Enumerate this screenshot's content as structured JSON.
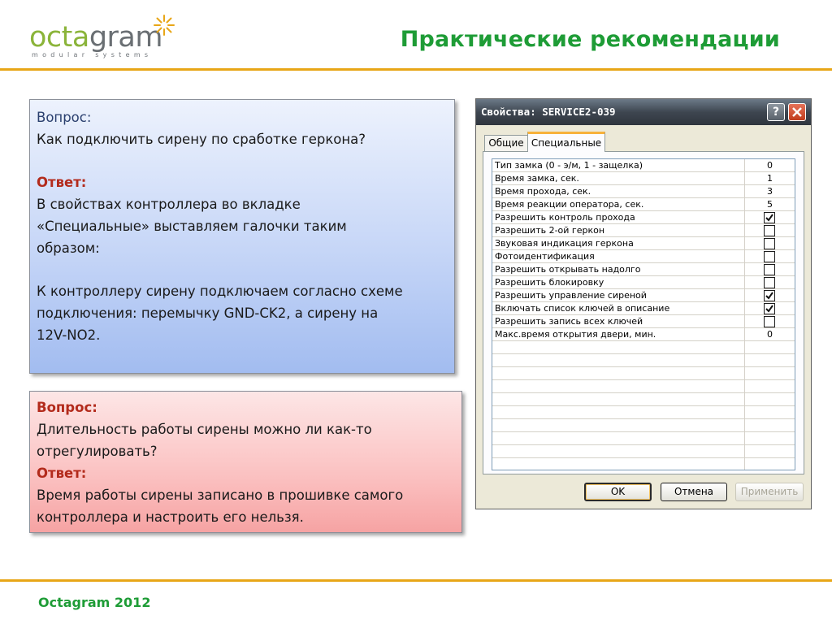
{
  "header": {
    "logo_word_part1": "octa",
    "logo_word_part2": "gram",
    "logo_tagline": "modular systems",
    "title": "Практические рекомендации"
  },
  "colors": {
    "accent_green": "#1e9c36",
    "rule_orange": "#e8a617",
    "answer_red": "#b32b1c"
  },
  "box1": {
    "question_label": "Вопрос:",
    "question_text": "Как подключить сирену по сработке геркона?",
    "answer_label": "Ответ:",
    "answer_line1": "В свойствах контроллера во вкладке",
    "answer_line2": "«Специальные» выставляем галочки таким",
    "answer_line3": "образом:",
    "answer2_line1": "К контроллеру сирену подключаем согласно схеме",
    "answer2_line2": "подключения:  перемычку GND-CK2, а сирену на",
    "answer2_line3": "12V-NO2."
  },
  "box2": {
    "question_label": "Вопрос:",
    "question_line1": "Длительность работы сирены можно ли как-то",
    "question_line2": "отрегулировать?",
    "answer_label": "Ответ:",
    "answer_line1": "Время работы сирены записано в прошивке самого",
    "answer_line2": "контроллера и настроить его нельзя."
  },
  "dialog": {
    "title": "Свойства: SERVICE2-039",
    "help_label": "?",
    "close_label": "X",
    "tabs": [
      "Общие",
      "Специальные"
    ],
    "properties": [
      {
        "name": "Тип замка (0 - э/м, 1 - защелка)",
        "value": "0"
      },
      {
        "name": "Время замка, сек.",
        "value": "1"
      },
      {
        "name": "Время прохода, сек.",
        "value": "3"
      },
      {
        "name": "Время реакции оператора, сек.",
        "value": "5"
      },
      {
        "name": "Разрешить контроль прохода",
        "checked": true
      },
      {
        "name": "Разрешить 2-ой геркон",
        "checked": false
      },
      {
        "name": "Звуковая индикация геркона",
        "checked": false
      },
      {
        "name": "Фотоидентификация",
        "checked": false
      },
      {
        "name": "Разрешить открывать надолго",
        "checked": false
      },
      {
        "name": "Разрешить блокировку",
        "checked": false
      },
      {
        "name": "Разрешить управление сиреной",
        "checked": true
      },
      {
        "name": "Включать список ключей в описание",
        "checked": true
      },
      {
        "name": "Разрешить запись всех ключей",
        "checked": false
      },
      {
        "name": "Макс.время открытия двери, мин.",
        "value": "0"
      }
    ],
    "empty_rows": 10,
    "buttons": {
      "ok": "OK",
      "cancel": "Отмена",
      "apply": "Применить"
    }
  },
  "footer": {
    "text": "Octagram  2012"
  }
}
